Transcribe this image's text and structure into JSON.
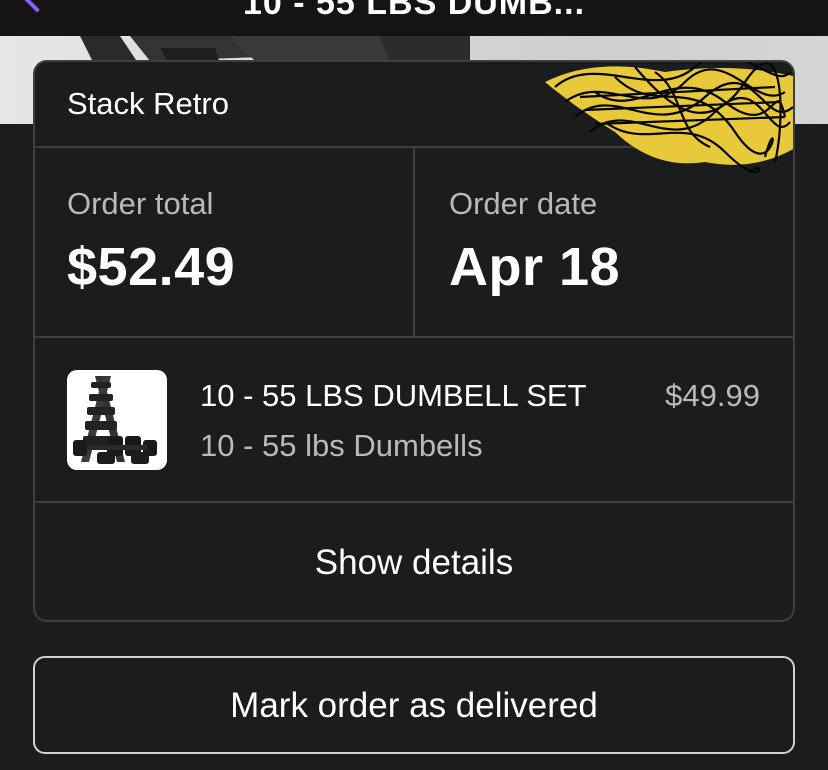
{
  "nav": {
    "title": "10 - 55 LBS DUMB...",
    "back_icon": "chevron-left-icon",
    "accent": "#8b5cf6"
  },
  "order": {
    "store_name": "Stack Retro",
    "total_label": "Order total",
    "total_value": "$52.49",
    "date_label": "Order date",
    "date_value": "Apr 18"
  },
  "item": {
    "title": "10 - 55 LBS DUMBELL SET",
    "subtitle": "10 - 55 lbs Dumbells",
    "price": "$49.99",
    "thumbnail_icon": "dumbbell-rack-image"
  },
  "actions": {
    "show_details": "Show details",
    "mark_delivered": "Mark order as delivered"
  },
  "colors": {
    "background": "#1b1c1e",
    "border": "#3d3e42",
    "muted_text": "#b8b9bd",
    "redaction_yellow": "#e8c93a"
  }
}
